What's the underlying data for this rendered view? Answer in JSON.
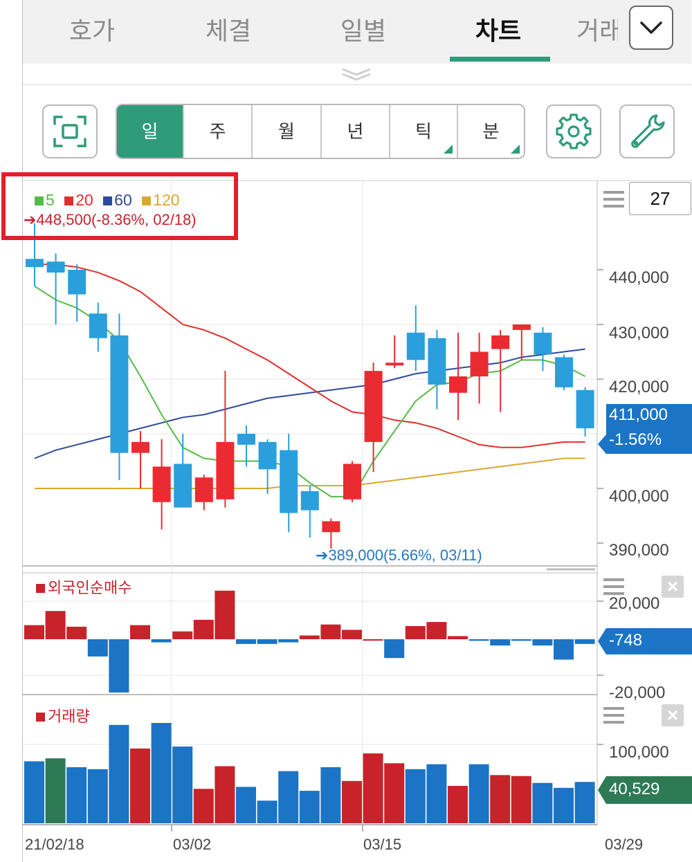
{
  "tabs": [
    "호가",
    "체결",
    "일별",
    "차트",
    "거래"
  ],
  "active_tab": "차트",
  "periods": [
    "일",
    "주",
    "월",
    "년",
    "틱",
    "분"
  ],
  "active_period": "일",
  "colors": {
    "accent": "#2e9c78",
    "up": "#ea2b31",
    "down": "#2b9fdc",
    "ma5": "#55bb46",
    "ma20": "#e0302e",
    "ma60": "#2d4a9c",
    "ma120": "#d9a830",
    "highlight": "#e0202a"
  },
  "main_chart": {
    "legend": [
      {
        "label": "5",
        "color": "#55bb46"
      },
      {
        "label": "20",
        "color": "#e0302e"
      },
      {
        "label": "60",
        "color": "#2d4a9c"
      },
      {
        "label": "120",
        "color": "#d9a830"
      }
    ],
    "high_note": "448,500(-8.36%, 02/18)",
    "low_note": "389,000(5.66%, 03/11)",
    "period_count": "27",
    "y_ticks": [
      "440,000",
      "430,000",
      "420,000",
      "400,000",
      "390,000"
    ],
    "current_price": "411,000",
    "change_pct": "-1.56%"
  },
  "foreign_panel": {
    "title": "외국인순매수",
    "y_ticks": [
      "20,000",
      "-20,000"
    ],
    "current": "-748"
  },
  "volume_panel": {
    "title": "거래량",
    "y_ticks": [
      "100,000"
    ],
    "current": "40,529"
  },
  "x_labels": [
    "21/02/18",
    "03/02",
    "03/15",
    "03/29"
  ],
  "chart_data": {
    "type": "bar",
    "candles": [
      {
        "o": 442000,
        "h": 448500,
        "l": 437000,
        "c": 440500
      },
      {
        "o": 441500,
        "h": 443000,
        "l": 430000,
        "c": 439500
      },
      {
        "o": 440000,
        "h": 441000,
        "l": 430500,
        "c": 435500
      },
      {
        "o": 432000,
        "h": 434000,
        "l": 425000,
        "c": 427500
      },
      {
        "o": 428000,
        "h": 432000,
        "l": 401500,
        "c": 406500
      },
      {
        "o": 406500,
        "h": 410500,
        "l": 400000,
        "c": 408500
      },
      {
        "o": 397500,
        "h": 409000,
        "l": 392500,
        "c": 404000
      },
      {
        "o": 404500,
        "h": 410000,
        "l": 398500,
        "c": 396500
      },
      {
        "o": 397500,
        "h": 402500,
        "l": 396000,
        "c": 402000
      },
      {
        "o": 398000,
        "h": 421500,
        "l": 396500,
        "c": 408500
      },
      {
        "o": 410000,
        "h": 411500,
        "l": 404000,
        "c": 408000
      },
      {
        "o": 408500,
        "h": 409000,
        "l": 399000,
        "c": 403500
      },
      {
        "o": 407000,
        "h": 410000,
        "l": 392000,
        "c": 395500
      },
      {
        "o": 399500,
        "h": 400500,
        "l": 391000,
        "c": 396000
      },
      {
        "o": 392000,
        "h": 394500,
        "l": 389000,
        "c": 394000
      },
      {
        "o": 398000,
        "h": 405000,
        "l": 397500,
        "c": 404500
      },
      {
        "o": 408500,
        "h": 423000,
        "l": 403000,
        "c": 421500
      },
      {
        "o": 422500,
        "h": 428000,
        "l": 422000,
        "c": 423000
      },
      {
        "o": 428500,
        "h": 433500,
        "l": 421500,
        "c": 423500
      },
      {
        "o": 427500,
        "h": 429000,
        "l": 414500,
        "c": 419000
      },
      {
        "o": 417500,
        "h": 428500,
        "l": 412500,
        "c": 420500
      },
      {
        "o": 420500,
        "h": 428500,
        "l": 415500,
        "c": 425000
      },
      {
        "o": 425500,
        "h": 429000,
        "l": 414000,
        "c": 428000
      },
      {
        "o": 429000,
        "h": 430000,
        "l": 423500,
        "c": 430000
      },
      {
        "o": 428500,
        "h": 429500,
        "l": 421500,
        "c": 424500
      },
      {
        "o": 424000,
        "h": 424500,
        "l": 418000,
        "c": 418500
      },
      {
        "o": 418000,
        "h": 418500,
        "l": 409500,
        "c": 411000
      }
    ],
    "ma5": [
      437000,
      434500,
      433000,
      430500,
      427000,
      420500,
      413500,
      407500,
      405500,
      405000,
      405000,
      405000,
      404000,
      401000,
      398500,
      398500,
      405000,
      410500,
      416000,
      419000,
      419500,
      421000,
      421500,
      423500,
      423500,
      422500,
      420500
    ],
    "ma20": [
      441000,
      441000,
      440500,
      439500,
      438000,
      436000,
      433000,
      430000,
      429000,
      427500,
      425500,
      423500,
      421000,
      418500,
      416000,
      414000,
      413500,
      412500,
      412000,
      411000,
      409500,
      408000,
      407500,
      407500,
      408000,
      408500,
      408500
    ],
    "ma60": [
      405500,
      407000,
      408000,
      409000,
      410000,
      411000,
      412000,
      413000,
      413500,
      414500,
      415500,
      416500,
      417000,
      417500,
      418000,
      418500,
      419000,
      420000,
      421000,
      421500,
      422000,
      422500,
      423000,
      424000,
      424500,
      425000,
      425500
    ],
    "ma120": [
      400000,
      400000,
      400000,
      400000,
      400000,
      400000,
      400000,
      400000,
      400000,
      400000,
      400000,
      400000,
      400500,
      400500,
      400500,
      400500,
      401000,
      401500,
      402000,
      402500,
      403000,
      403500,
      404000,
      404500,
      405000,
      405500,
      405500
    ],
    "foreign": [
      4500,
      9000,
      4000,
      -5500,
      -17000,
      4500,
      -1000,
      2500,
      6200,
      15500,
      -1500,
      -1500,
      -1000,
      1200,
      4700,
      3000,
      0,
      -6000,
      4200,
      5500,
      1000,
      -500,
      -2000,
      -500,
      -2000,
      -6500,
      -1500,
      -748
    ],
    "volume": [
      63000,
      66000,
      57000,
      55000,
      100000,
      76000,
      102000,
      78000,
      35000,
      58000,
      37000,
      23000,
      53000,
      33000,
      57000,
      43000,
      71000,
      61000,
      55000,
      60000,
      38000,
      60000,
      49000,
      48000,
      41000,
      36000,
      42000
    ],
    "volume_dir": [
      "down",
      "green",
      "down",
      "down",
      "down",
      "up",
      "down",
      "down",
      "up",
      "up",
      "down",
      "down",
      "down",
      "down",
      "down",
      "up",
      "up",
      "up",
      "down",
      "down",
      "up",
      "down",
      "up",
      "up",
      "down",
      "down",
      "down"
    ]
  }
}
